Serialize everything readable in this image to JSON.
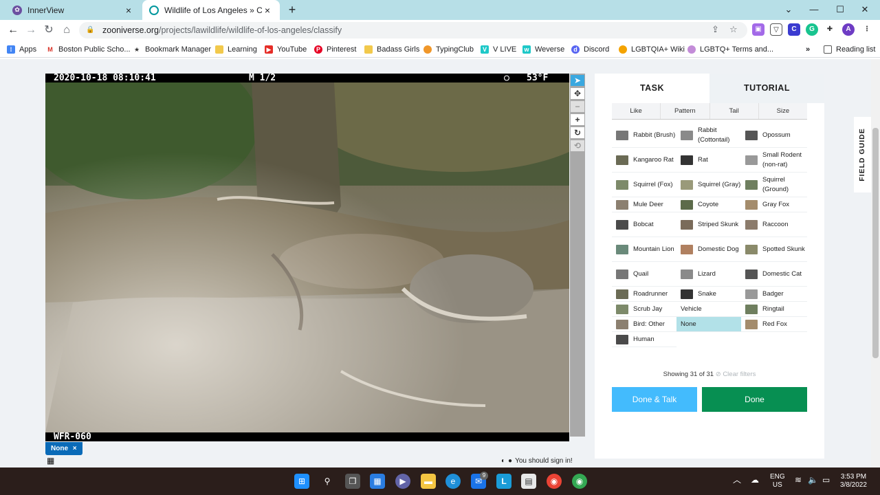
{
  "browser": {
    "tabs": [
      {
        "title": "InnerView",
        "active": false
      },
      {
        "title": "Wildlife of Los Angeles » Classify",
        "active": true
      }
    ],
    "url_host": "zooniverse.org",
    "url_path": "/projects/lawildlife/wildlife-of-los-angeles/classify",
    "profile_initial": "A",
    "bookmarks": [
      "Apps",
      "Boston Public Scho...",
      "Bookmark Manager",
      "Learning",
      "YouTube",
      "Pinterest",
      "Badass Girls",
      "TypingClub",
      "V LIVE",
      "Weverse",
      "Discord",
      "LGBTQIA+ Wiki",
      "LGBTQ+ Terms and..."
    ],
    "overflow_label": "»",
    "reading_list": "Reading list"
  },
  "camera": {
    "timestamp": "2020-10-18 08:10:41",
    "mode": "M 1/2",
    "temperature": "53°F",
    "station": "WFR-060"
  },
  "subject": {
    "chip_label": "None",
    "chip_close": "×",
    "signin_text": "You should sign in!"
  },
  "panel": {
    "tab_task": "TASK",
    "tab_tutorial": "TUTORIAL",
    "filters": [
      "Like",
      "Pattern",
      "Tail",
      "Size"
    ],
    "choices": [
      [
        "Rabbit (Brush)",
        "Rabbit (Cottontail)",
        "Opossum"
      ],
      [
        "Kangaroo Rat",
        "Rat",
        "Small Rodent (non-rat)"
      ],
      [
        "Squirrel (Fox)",
        "Squirrel (Gray)",
        "Squirrel (Ground)"
      ],
      [
        "Mule Deer",
        "Coyote",
        "Gray Fox"
      ],
      [
        "Bobcat",
        "Striped Skunk",
        "Raccoon"
      ],
      [
        "Mountain Lion",
        "Domestic Dog",
        "Spotted Skunk"
      ],
      [
        "Quail",
        "Lizard",
        "Domestic Cat"
      ],
      [
        "Roadrunner",
        "Snake",
        "Badger"
      ],
      [
        "Scrub Jay",
        "Vehicle",
        "Ringtail"
      ],
      [
        "Bird: Other",
        "None",
        "Red Fox"
      ],
      [
        "Human"
      ]
    ],
    "selected_choice": "None",
    "showing_text": "Showing 31 of 31",
    "clear_filters": "Clear filters",
    "done_talk": "Done & Talk",
    "done": "Done",
    "field_guide": "FIELD GUIDE"
  },
  "taskbar": {
    "mail_badge": "9",
    "lang_line1": "ENG",
    "lang_line2": "US",
    "time": "3:53 PM",
    "date": "3/8/2022"
  },
  "colors": {
    "tab_strip": "#b7dfe7",
    "done_talk_bg": "#43bbfd",
    "done_bg": "#078f52",
    "selected_choice_bg": "#b2e1e8",
    "subject_chip_bg": "#0a6bb8"
  }
}
